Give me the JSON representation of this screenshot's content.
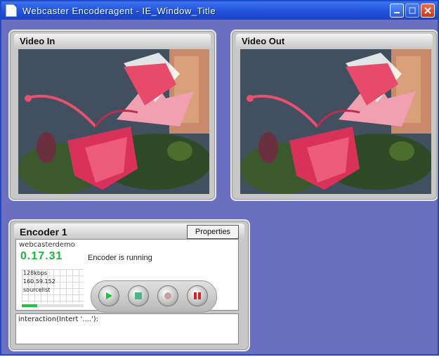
{
  "window": {
    "title": "Webcaster Encoderagent - IE_Window_Title",
    "controls": [
      "minimize",
      "maximize",
      "close"
    ]
  },
  "video_in": {
    "title": "Video In"
  },
  "video_out": {
    "title": "Video Out"
  },
  "encoder": {
    "title": "Encoder 1",
    "properties_label": "Properties",
    "name": "webcasterdemo",
    "elapsed_time": "0.17.31",
    "status": "Encoder is running",
    "stats": [
      "128kbps",
      "160.59.152",
      "sourcelist"
    ],
    "level": 0.25,
    "colors": {
      "time": "#18b83a",
      "play": "#22c33a",
      "stop": "#4bb58a",
      "pause": "#d9232a"
    },
    "buttons": [
      "play",
      "stop",
      "record",
      "pause"
    ],
    "log_text": "interaction(Intert '....'):"
  }
}
